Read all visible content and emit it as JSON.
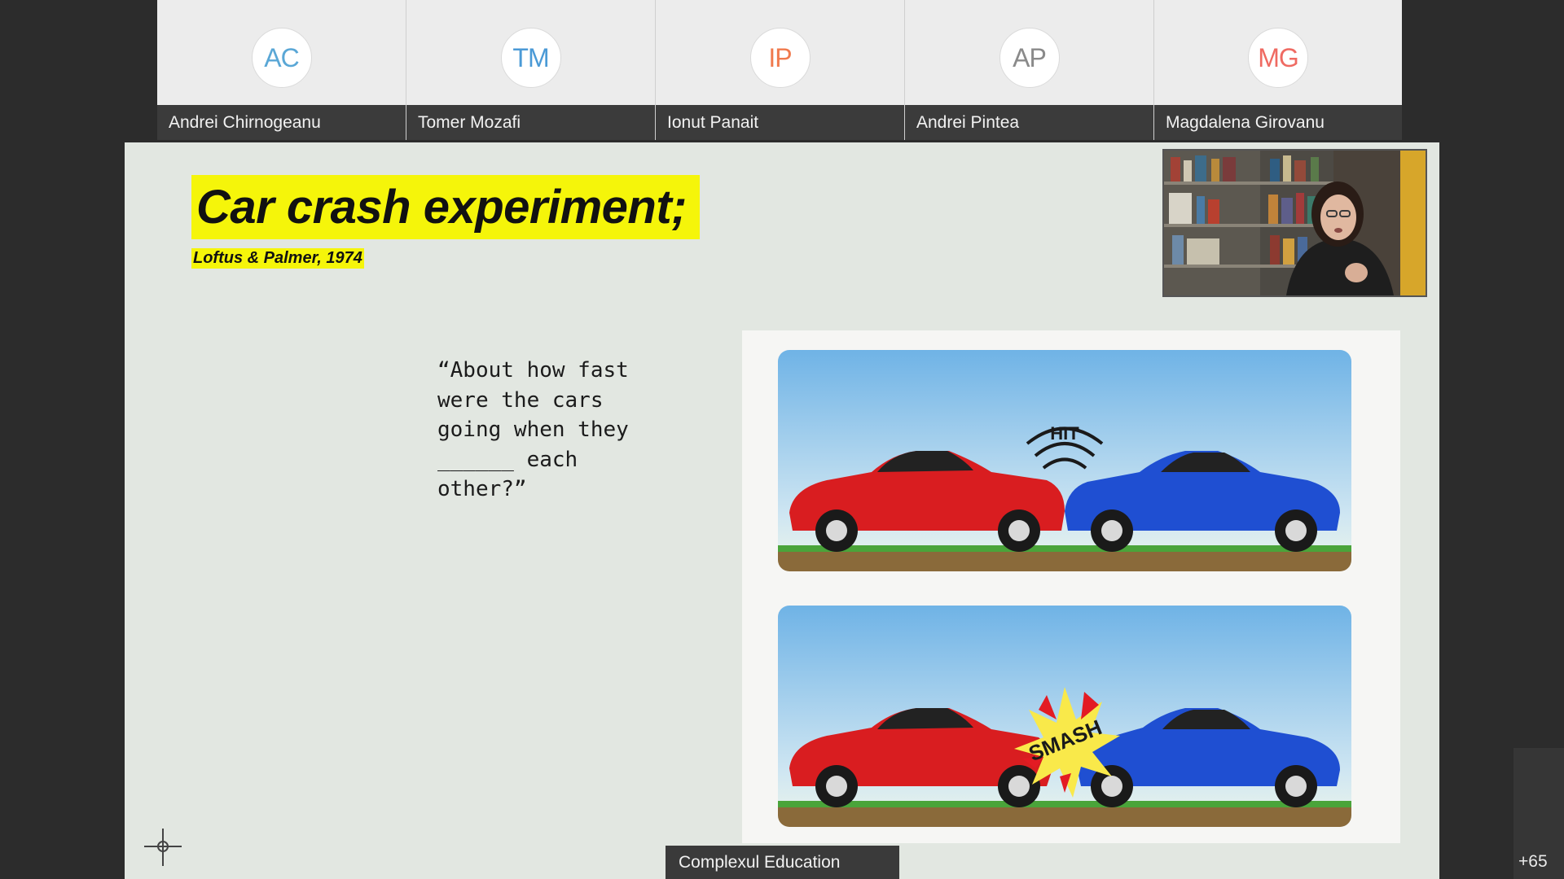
{
  "participants": [
    {
      "initials": "AC",
      "name": "Andrei Chirnogeanu",
      "color": "#5aa7d6"
    },
    {
      "initials": "TM",
      "name": "Tomer Mozafi",
      "color": "#4b9ad6"
    },
    {
      "initials": "IP",
      "name": "Ionut Panait",
      "color": "#f07a4e"
    },
    {
      "initials": "AP",
      "name": "Andrei Pintea",
      "color": "#8a8a8a"
    },
    {
      "initials": "MG",
      "name": "Magdalena Girovanu",
      "color": "#ef6a62"
    }
  ],
  "slide": {
    "title": "Car crash experiment;",
    "subtitle": "Loftus & Palmer, 1974",
    "quote": "“About how fast\nwere the cars\ngoing when they\n______ each\nother?”",
    "panel_top_label": "HIT",
    "panel_bottom_label": "SMASH",
    "highlight_color": "#f5f50a"
  },
  "presenter": {
    "name": "Complexul Education"
  },
  "overflow": {
    "count": "+65"
  },
  "icons": {
    "crosshair": "crosshair-icon",
    "speaker": "speaker-video"
  }
}
